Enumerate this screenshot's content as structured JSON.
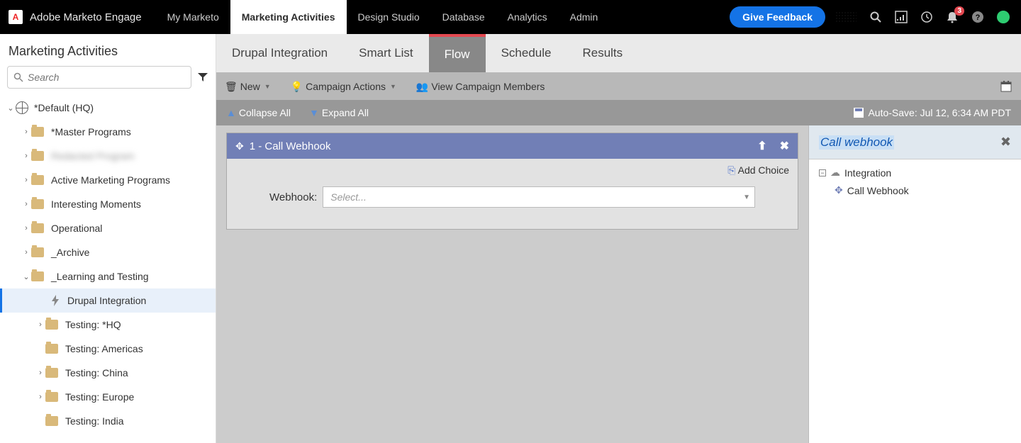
{
  "topbar": {
    "brand": "Adobe Marketo Engage",
    "logo_letter": "A",
    "nav": {
      "my_marketo": "My Marketo",
      "marketing_activities": "Marketing Activities",
      "design_studio": "Design Studio",
      "database": "Database",
      "analytics": "Analytics",
      "admin": "Admin"
    },
    "feedback": "Give Feedback",
    "notification_count": "3"
  },
  "sidebar": {
    "title": "Marketing Activities",
    "search_placeholder": "Search",
    "tree": {
      "root": "*Default (HQ)",
      "master": "*Master Programs",
      "redacted": "Redacted Program",
      "active": "Active Marketing Programs",
      "interesting": "Interesting Moments",
      "operational": "Operational",
      "archive": "_Archive",
      "learning": "_Learning and Testing",
      "drupal": "Drupal Integration",
      "test_hq": "Testing: *HQ",
      "test_americas": "Testing: Americas",
      "test_china": "Testing: China",
      "test_europe": "Testing: Europe",
      "test_india": "Testing: India"
    }
  },
  "tabs": {
    "drupal": "Drupal Integration",
    "smart_list": "Smart List",
    "flow": "Flow",
    "schedule": "Schedule",
    "results": "Results"
  },
  "toolbar2": {
    "new": "New",
    "campaign_actions": "Campaign Actions",
    "view_members": "View Campaign Members"
  },
  "toolbar3": {
    "collapse": "Collapse All",
    "expand": "Expand All",
    "autosave": "Auto-Save: Jul 12, 6:34 AM PDT"
  },
  "flow": {
    "step_title": "1 - Call Webhook",
    "add_choice": "Add Choice",
    "webhook_label": "Webhook:",
    "webhook_placeholder": "Select..."
  },
  "side_panel": {
    "title": "Call webhook",
    "category": "Integration",
    "item": "Call Webhook"
  }
}
